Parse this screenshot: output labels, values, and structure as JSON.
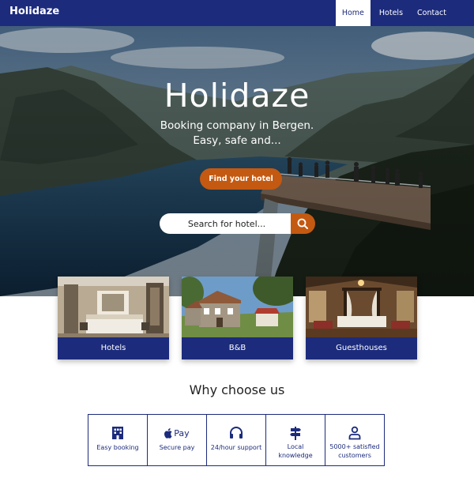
{
  "nav": {
    "logo": "Holidaze",
    "links": [
      {
        "label": "Home",
        "active": true
      },
      {
        "label": "Hotels",
        "active": false
      },
      {
        "label": "Contact",
        "active": false
      }
    ]
  },
  "hero": {
    "title": "Holidaze",
    "subtitle_line1": "Booking company in Bergen.",
    "subtitle_line2": "Easy, safe and...",
    "cta_label": "Find your hotel",
    "search_placeholder": "Search for hotel..."
  },
  "categories": [
    {
      "label": "Hotels"
    },
    {
      "label": "B&B"
    },
    {
      "label": "Guesthouses"
    }
  ],
  "why": {
    "title": "Why choose us",
    "features": [
      {
        "icon": "building-icon",
        "line1": "Easy booking",
        "line2": ""
      },
      {
        "icon": "apple-pay-icon",
        "icon_text": "Pay",
        "line1": "Secure pay",
        "line2": ""
      },
      {
        "icon": "headphones-icon",
        "line1": "24/hour support",
        "line2": ""
      },
      {
        "icon": "signpost-icon",
        "line1": "Local",
        "line2": "knowledge"
      },
      {
        "icon": "person-icon",
        "line1": "5000+ satisfied",
        "line2": "customers"
      }
    ]
  },
  "colors": {
    "brand_navy": "#1c2b7c",
    "accent_orange": "#c45911",
    "white": "#ffffff"
  }
}
